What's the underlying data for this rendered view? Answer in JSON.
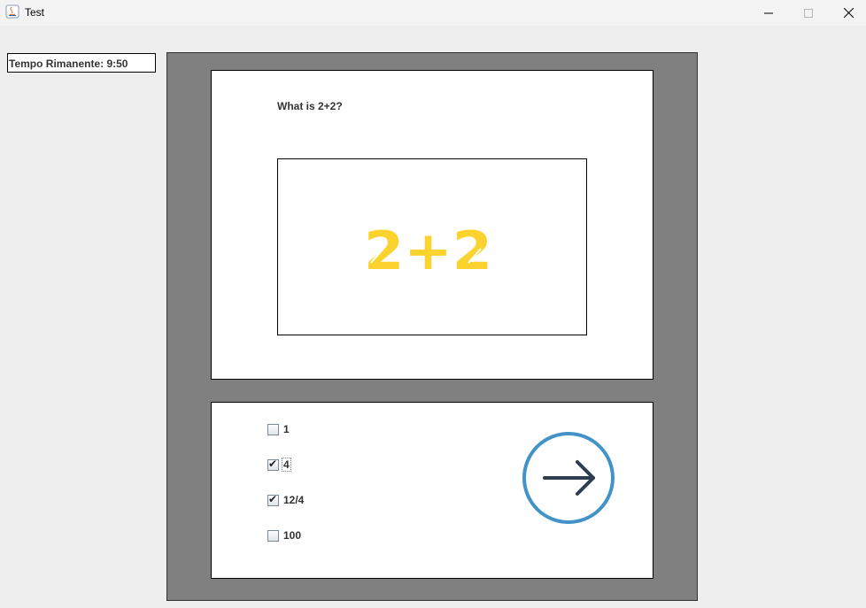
{
  "window": {
    "title": "Test"
  },
  "timer": {
    "text": "Tempo Rimanente: 9:50"
  },
  "question": {
    "text": "What is 2+2?",
    "image_text": "2+2",
    "image_color": "#fcd22e"
  },
  "options": [
    {
      "label": "1",
      "checked": false
    },
    {
      "label": "4",
      "checked": true
    },
    {
      "label": "12/4",
      "checked": true
    },
    {
      "label": "100",
      "checked": false
    }
  ],
  "next_button": {
    "icon": "arrow-right-icon",
    "ring_color": "#4393c8",
    "arrow_color": "#2c3e50"
  },
  "colors": {
    "panel_gray": "#808080",
    "background": "#eeeeee"
  }
}
